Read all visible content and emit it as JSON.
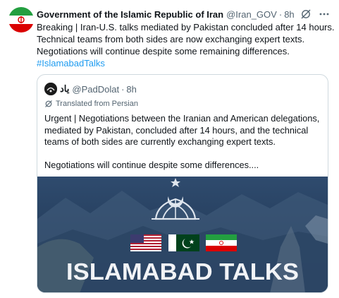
{
  "tweet": {
    "author_name": "Government of the Islamic Republic of Iran",
    "handle": "@Iran_GOV",
    "separator": "·",
    "time": "8h",
    "lines": [
      "Breaking | Iran-U.S. talks mediated by Pakistan concluded after 14 hours.",
      "Technical teams from both sides are now exchanging expert texts.",
      "Negotiations will continue despite some remaining differences."
    ],
    "hashtag": "#IslamabadTalks",
    "icons": {
      "avatar": "iran-flag-avatar",
      "grok": "grok-icon",
      "more": "more-icon"
    }
  },
  "quote": {
    "author_name": "یاد",
    "handle": "@PadDolat",
    "separator": "·",
    "time": "8h",
    "translated_label": "Translated from Persian",
    "paragraph1": [
      "Urgent | Negotiations between the Iranian and American delegations,",
      "mediated by Pakistan, concluded after 14 hours, and the technical",
      "teams of both sides are currently exchanging expert texts."
    ],
    "paragraph2": "Negotiations will continue despite some differences....",
    "media": {
      "title": "ISLAMABAD TALKS",
      "flags": [
        "us-flag",
        "pakistan-flag",
        "iran-flag"
      ],
      "emblem": "islamabad-talks-emblem",
      "colors": {
        "sky_top": "#2e4a6d",
        "sky_bottom": "#1d3450",
        "title": "#f2f4f7"
      }
    }
  }
}
